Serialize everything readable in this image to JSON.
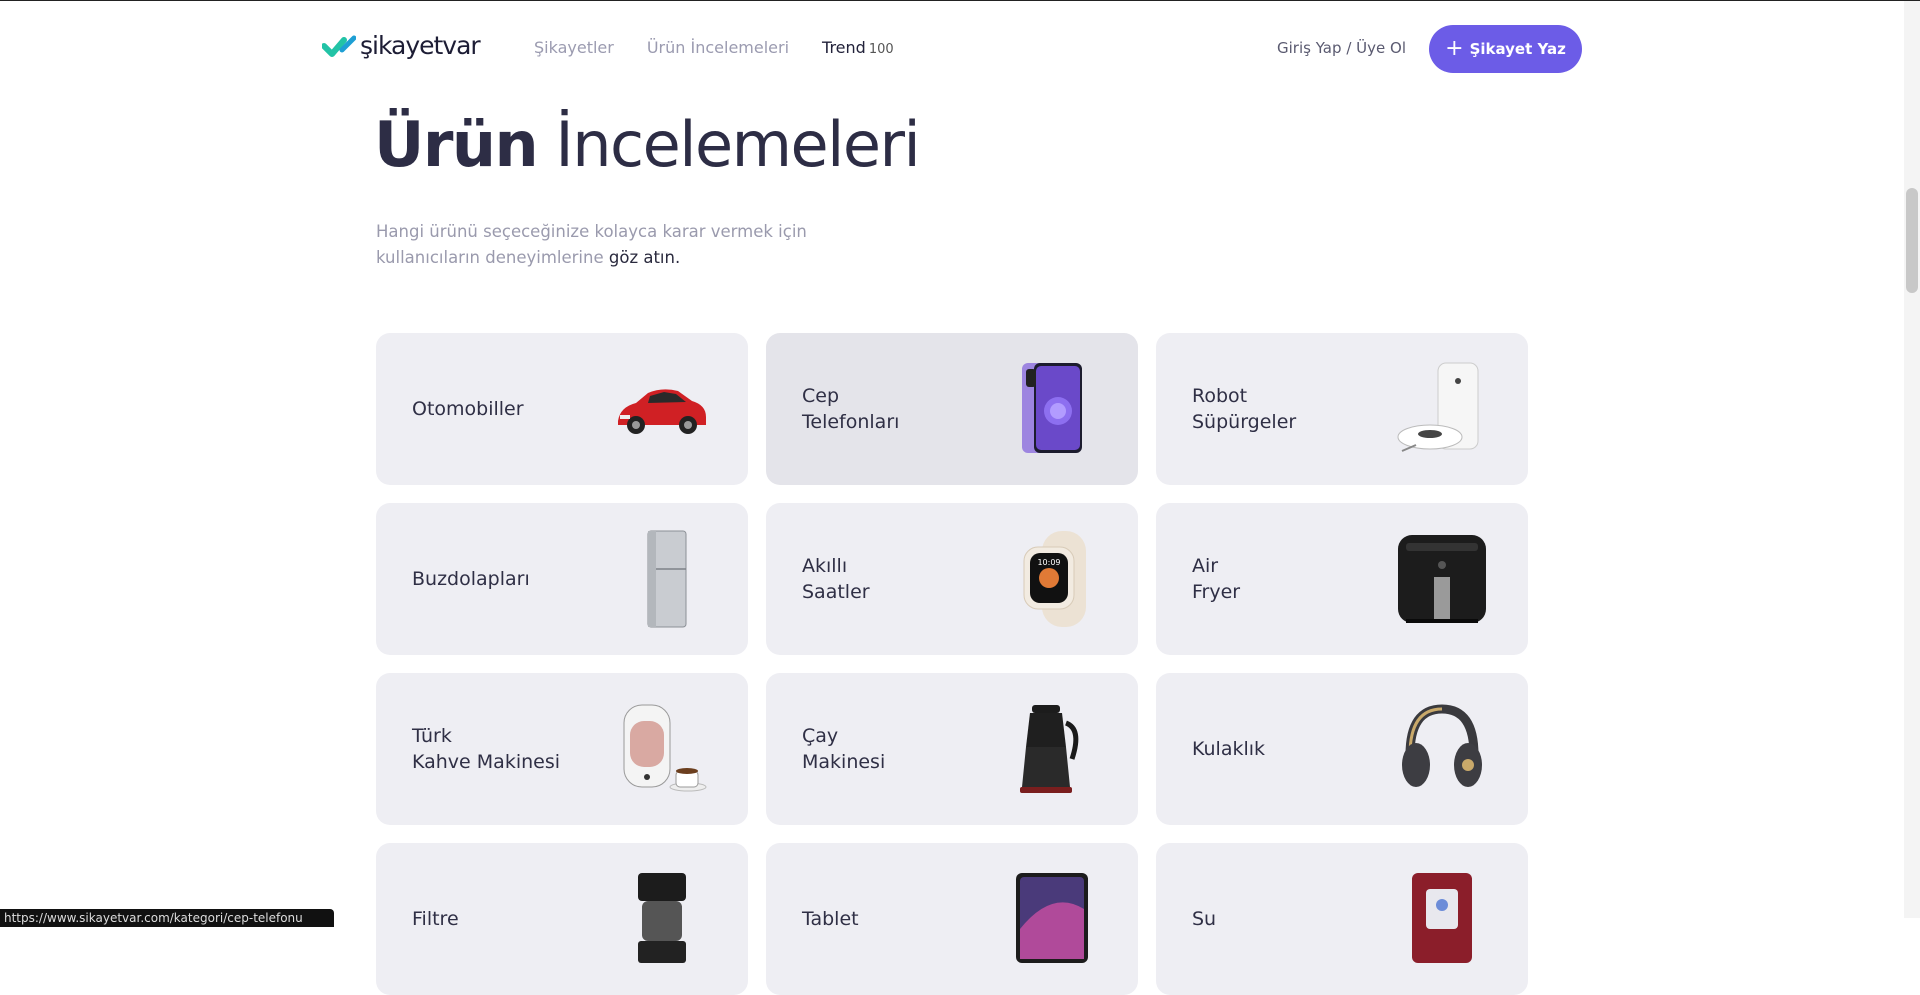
{
  "header": {
    "logo_text": "şikayetvar",
    "nav": [
      {
        "label": "Şikayetler"
      },
      {
        "label": "Ürün İncelemeleri"
      },
      {
        "label": "Trend",
        "count": "100"
      }
    ],
    "auth": {
      "login": "Giriş Yap",
      "separator": "/",
      "register": "Üye Ol"
    },
    "cta": {
      "icon": "plus-icon",
      "label": "Şikayet Yaz"
    }
  },
  "page": {
    "title_bold": "Ürün",
    "title_rest": "İncelemeleri",
    "subtitle_muted": "Hangi ürünü seçeceğinize kolayca karar vermek için kullanıcıların deneyimlerine",
    "subtitle_dark": "göz atın."
  },
  "categories": [
    {
      "label": "Otomobiller",
      "icon": "car-icon"
    },
    {
      "label": "Cep\nTelefonları",
      "icon": "smartphone-icon"
    },
    {
      "label": "Robot\nSüpürgeler",
      "icon": "robot-vacuum-icon"
    },
    {
      "label": "Buzdolapları",
      "icon": "refrigerator-icon"
    },
    {
      "label": "Akıllı\nSaatler",
      "icon": "smartwatch-icon"
    },
    {
      "label": "Air\nFryer",
      "icon": "air-fryer-icon"
    },
    {
      "label": "Türk\nKahve Makinesi",
      "icon": "coffee-machine-icon"
    },
    {
      "label": "Çay\nMakinesi",
      "icon": "tea-maker-icon"
    },
    {
      "label": "Kulaklık",
      "icon": "headphones-icon"
    },
    {
      "label": "Filtre",
      "icon": "filter-coffee-icon"
    },
    {
      "label": "Tablet",
      "icon": "tablet-icon"
    },
    {
      "label": "Su",
      "icon": "water-dispenser-icon"
    }
  ],
  "status_bar": {
    "url": "https://www.sikayetvar.com/kategori/cep-telefonu"
  },
  "colors": {
    "accent": "#6c5ce7",
    "logo_mark": "#22c3a6",
    "card_bg": "#eeeef3"
  }
}
